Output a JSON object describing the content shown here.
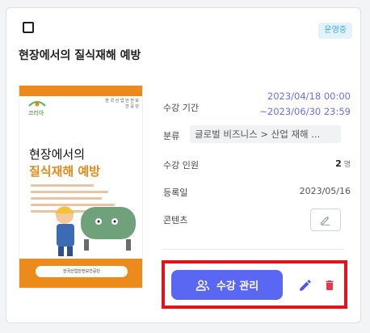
{
  "card": {
    "status_badge": "운영중",
    "title": "현장에서의 질식재해 예방",
    "thumbnail": {
      "logo_text": "코리아",
      "publisher_lines": "한 국 산 업 안 전 보 건 공 단",
      "title_line1": "현장에서의",
      "title_line2": "질식재해 예방",
      "org_text": "한국산업안전보건공단"
    },
    "info": {
      "period_label": "수강 기간",
      "period_start": "2023/04/18 00:00",
      "period_end": "~2023/06/30 23:59",
      "category_label": "분류",
      "category_value": "글로벌 비즈니스 > 산업 재해 ...",
      "enrollment_label": "수강 인원",
      "enrollment_count": "2",
      "enrollment_unit": "명",
      "registered_label": "등록일",
      "registered_date": "2023/05/16",
      "content_label": "콘텐츠"
    },
    "actions": {
      "manage_label": "수강 관리"
    }
  },
  "colors": {
    "accent": "#5a67f2",
    "status_bg": "#e4f3fb",
    "status_text": "#44a7d9",
    "highlight_frame": "#e0141a",
    "delete_icon": "#e53950",
    "edit_icon": "#4a58e8",
    "cover_orange": "#ec8a1c"
  },
  "icons": [
    "checkbox-icon",
    "people-icon",
    "pencil-icon",
    "trash-icon"
  ]
}
